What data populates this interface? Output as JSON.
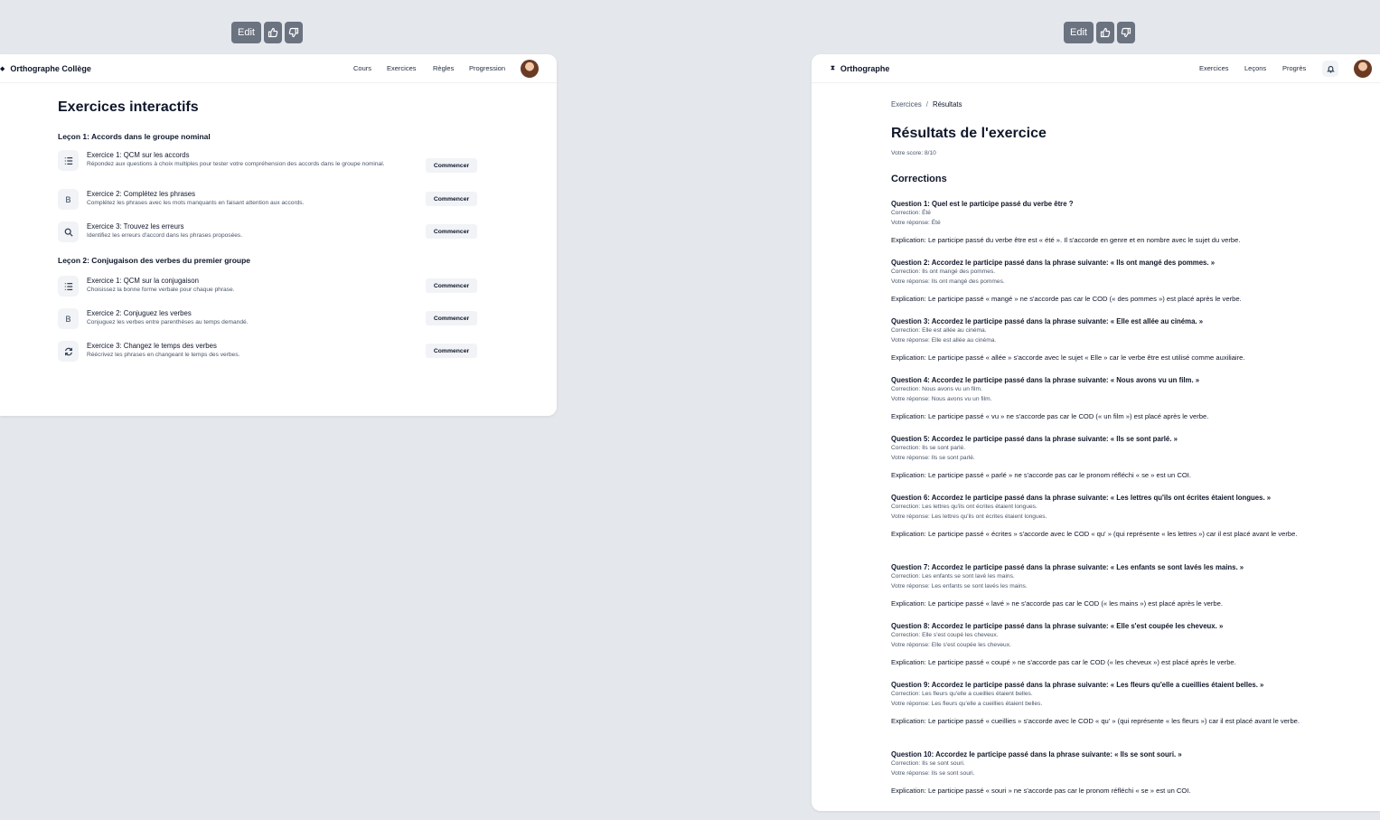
{
  "toolbar_left": {
    "edit_label": "Edit"
  },
  "toolbar_right": {
    "edit_label": "Edit"
  },
  "left": {
    "brand": "Orthographe Collège",
    "nav": [
      "Cours",
      "Exercices",
      "Règles",
      "Progression"
    ],
    "title": "Exercices interactifs",
    "lessons": [
      {
        "title": "Leçon 1: Accords dans le groupe nominal",
        "exercises": [
          {
            "icon": "list-icon",
            "title": "Exercice 1: QCM sur les accords",
            "desc": "Répondez aux questions à choix multiples pour tester votre compréhension des accords dans le groupe nominal.",
            "button": "Commencer"
          },
          {
            "icon": "bold-b-icon",
            "title": "Exercice 2: Complétez les phrases",
            "desc": "Complétez les phrases avec les mots manquants en faisant attention aux accords.",
            "button": "Commencer"
          },
          {
            "icon": "search-icon",
            "title": "Exercice 3: Trouvez les erreurs",
            "desc": "Identifiez les erreurs d'accord dans les phrases proposées.",
            "button": "Commencer"
          }
        ]
      },
      {
        "title": "Leçon 2: Conjugaison des verbes du premier groupe",
        "exercises": [
          {
            "icon": "list-icon",
            "title": "Exercice 1: QCM sur la conjugaison",
            "desc": "Choisissez la bonne forme verbale pour chaque phrase.",
            "button": "Commencer"
          },
          {
            "icon": "bold-b-icon",
            "title": "Exercice 2: Conjuguez les verbes",
            "desc": "Conjuguez les verbes entre parenthèses au temps demandé.",
            "button": "Commencer"
          },
          {
            "icon": "refresh-icon",
            "title": "Exercice 3: Changez le temps des verbes",
            "desc": "Réécrivez les phrases en changeant le temps des verbes.",
            "button": "Commencer"
          }
        ]
      }
    ]
  },
  "right": {
    "brand": "Orthographe",
    "nav": [
      "Exercices",
      "Leçons",
      "Progrès"
    ],
    "breadcrumb": {
      "parent": "Exercices",
      "separator": "/",
      "current": "Résultats"
    },
    "title": "Résultats de l'exercice",
    "score": "Votre score: 8/10",
    "section": "Corrections",
    "status_color": "#16a34a",
    "questions": [
      {
        "title": "Question 1: Quel est le participe passé du verbe être ?",
        "correction": "Correction: Été",
        "answer": "Votre réponse: Été",
        "explanation": "Explication: Le participe passé du verbe être est « été ». Il s'accorde en genre et en nombre avec le sujet du verbe."
      },
      {
        "title": "Question 2: Accordez le participe passé dans la phrase suivante: « Ils ont mangé des pommes. »",
        "correction": "Correction: Ils ont mangé des pommes.",
        "answer": "Votre réponse: Ils ont mangé des pommes.",
        "explanation": "Explication: Le participe passé « mangé » ne s'accorde pas car le COD (« des pommes ») est placé après le verbe."
      },
      {
        "title": "Question 3: Accordez le participe passé dans la phrase suivante: « Elle est allée au cinéma. »",
        "correction": "Correction: Elle est allée au cinéma.",
        "answer": "Votre réponse: Elle est allée au cinéma.",
        "explanation": "Explication: Le participe passé « allée » s'accorde avec le sujet « Elle » car le verbe être est utilisé comme auxiliaire."
      },
      {
        "title": "Question 4: Accordez le participe passé dans la phrase suivante: « Nous avons vu un film. »",
        "correction": "Correction: Nous avons vu un film.",
        "answer": "Votre réponse: Nous avons vu un film.",
        "explanation": "Explication: Le participe passé « vu » ne s'accorde pas car le COD (« un film ») est placé après le verbe."
      },
      {
        "title": "Question 5: Accordez le participe passé dans la phrase suivante: « Ils se sont parlé. »",
        "correction": "Correction: Ils se sont parlé.",
        "answer": "Votre réponse: Ils se sont parlé.",
        "explanation": "Explication: Le participe passé « parlé » ne s'accorde pas car le pronom réfléchi « se » est un COI."
      },
      {
        "title": "Question 6: Accordez le participe passé dans la phrase suivante: « Les lettres qu'ils ont écrites étaient longues. »",
        "correction": "Correction: Les lettres qu'ils ont écrites étaient longues.",
        "answer": "Votre réponse: Les lettres qu'ils ont écrites étaient longues.",
        "explanation": "Explication: Le participe passé « écrites » s'accorde avec le COD « qu' » (qui représente « les lettres ») car il est placé avant le verbe."
      },
      {
        "title": "Question 7: Accordez le participe passé dans la phrase suivante: « Les enfants se sont lavés les mains. »",
        "correction": "Correction: Les enfants se sont lavé les mains.",
        "answer": "Votre réponse: Les enfants se sont lavés les mains.",
        "explanation": "Explication: Le participe passé « lavé » ne s'accorde pas car le COD (« les mains ») est placé après le verbe."
      },
      {
        "title": "Question 8: Accordez le participe passé dans la phrase suivante: « Elle s'est coupée les cheveux. »",
        "correction": "Correction: Elle s'est coupé les cheveux.",
        "answer": "Votre réponse: Elle s'est coupée les cheveux.",
        "explanation": "Explication: Le participe passé « coupé » ne s'accorde pas car le COD (« les cheveux ») est placé après le verbe."
      },
      {
        "title": "Question 9: Accordez le participe passé dans la phrase suivante: « Les fleurs qu'elle a cueillies étaient belles. »",
        "correction": "Correction: Les fleurs qu'elle a cueillies étaient belles.",
        "answer": "Votre réponse: Les fleurs qu'elle a cueillies étaient belles.",
        "explanation": "Explication: Le participe passé « cueillies » s'accorde avec le COD « qu' » (qui représente « les fleurs ») car il est placé avant le verbe."
      },
      {
        "title": "Question 10: Accordez le participe passé dans la phrase suivante: « Ils se sont souri. »",
        "correction": "Correction: Ils se sont souri.",
        "answer": "Votre réponse: Ils se sont souri.",
        "explanation": "Explication: Le participe passé « souri » ne s'accorde pas car le pronom réfléchi « se » est un COI."
      }
    ]
  }
}
